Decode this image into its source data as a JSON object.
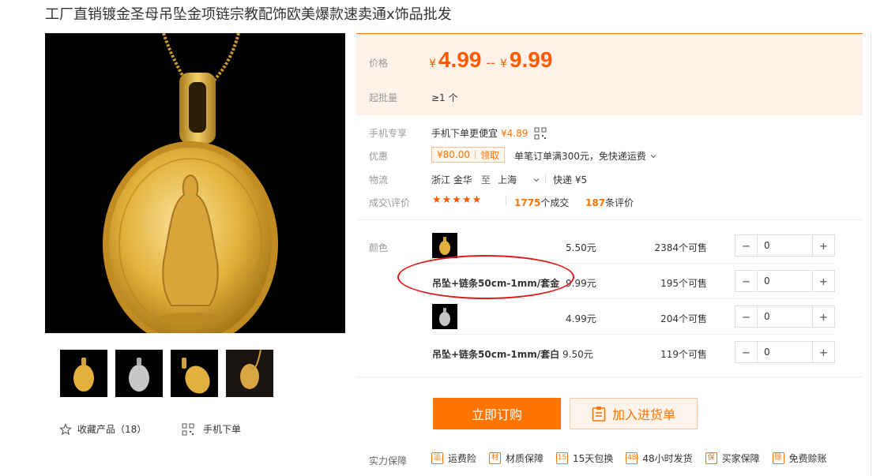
{
  "product": {
    "title": "工厂直销镀金圣母吊坠金项链宗教配饰欧美爆款速卖通x饰品批发"
  },
  "gallery": {
    "favorite_label": "收藏产品（18）",
    "mobile_order_label": "手机下单"
  },
  "price_section": {
    "price_label": "价格",
    "currency": "¥",
    "price_min": "4.99",
    "separator": "--",
    "price_max": "9.99",
    "moq_label": "起批量",
    "moq_value": "≥1 个"
  },
  "info": {
    "mobile_label": "手机专享",
    "mobile_text": "手机下单更便宜",
    "mobile_price": "¥4.89",
    "promo_label": "优惠",
    "coupon_amount": "¥80.00",
    "coupon_action": "领取",
    "promo_text": "单笔订单满300元，免快递运费",
    "logistics_label": "物流",
    "origin": "浙江 金华",
    "to_text": "至",
    "destination": "上海",
    "shipping": "快递 ¥5",
    "reviews_label": "成交\\评价",
    "stars": "★★★★★",
    "deals_count": "1775",
    "deals_text": "个成交",
    "review_count": "187",
    "review_text": "条评价"
  },
  "sku": {
    "color_label": "颜色",
    "rows": [
      {
        "name": "",
        "price": "5.50元",
        "stock": "2384个可售",
        "qty": "0"
      },
      {
        "name": "吊坠+链条50cm-1mm/套金",
        "price": "9.99元",
        "stock": "195个可售",
        "qty": "0"
      },
      {
        "name": "",
        "price": "4.99元",
        "stock": "204个可售",
        "qty": "0"
      },
      {
        "name": "吊坠+链条50cm-1mm/套白",
        "price": "9.50元",
        "stock": "119个可售",
        "qty": "0"
      }
    ],
    "minus": "−",
    "plus": "+"
  },
  "actions": {
    "buy_now": "立即订购",
    "add_to_cart": "加入进货单"
  },
  "guarantees": {
    "label": "实力保障",
    "items": [
      {
        "icon": "freight-insurance-icon",
        "glyph": "运",
        "text": "运费险"
      },
      {
        "icon": "material-guarantee-icon",
        "glyph": "材",
        "text": "材质保障"
      },
      {
        "icon": "15-day-exchange-icon",
        "glyph": "15",
        "text": "15天包换"
      },
      {
        "icon": "48h-shipping-icon",
        "glyph": "48",
        "text": "48小时发货"
      },
      {
        "icon": "buyer-protection-icon",
        "glyph": "保",
        "text": "买家保障"
      },
      {
        "icon": "free-credit-icon",
        "glyph": "赊",
        "text": "免费赊账"
      }
    ]
  },
  "colors": {
    "accent": "#ff7300",
    "price": "#ff5a00",
    "price_bg": "#fff2e8",
    "annotation": "#e0191a"
  }
}
